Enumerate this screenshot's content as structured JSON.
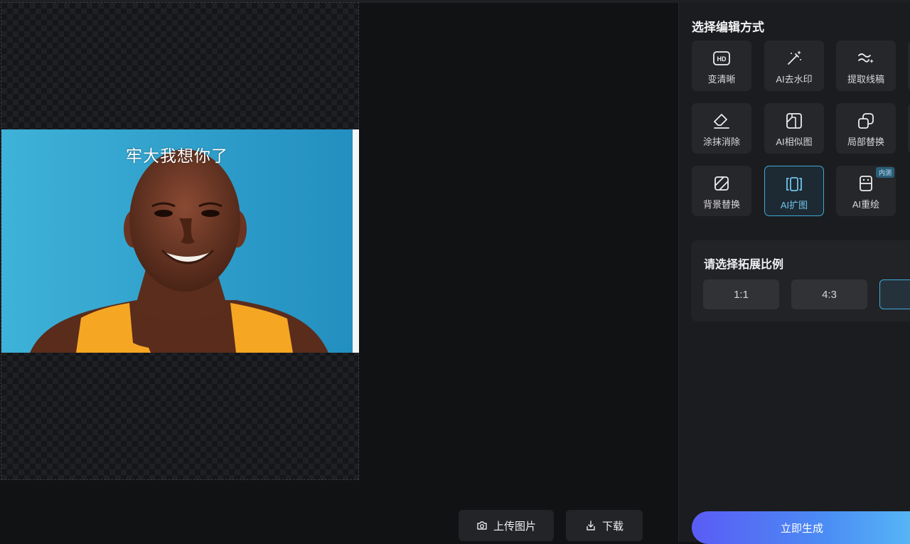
{
  "canvas": {
    "caption": "牢大我想你了"
  },
  "toolbar": {
    "upload_label": "上传图片",
    "download_label": "下载"
  },
  "panel": {
    "title": "选择编辑方式",
    "tools": [
      {
        "label": "变清晰",
        "icon": "hd-icon"
      },
      {
        "label": "AI去水印",
        "icon": "magic-wand-icon"
      },
      {
        "label": "提取线稿",
        "icon": "line-sparkle-icon"
      },
      {
        "label": "涂抹消除",
        "icon": "eraser-icon"
      },
      {
        "label": "AI相似图",
        "icon": "similar-image-icon"
      },
      {
        "label": "局部替换",
        "icon": "replace-icon"
      },
      {
        "label": "背景替换",
        "icon": "background-icon"
      },
      {
        "label": "AI扩图",
        "icon": "expand-icon",
        "active": true
      },
      {
        "label": "AI重绘",
        "icon": "redraw-icon",
        "badge": "内测"
      }
    ],
    "ratio": {
      "title": "请选择拓展比例",
      "options": [
        "1:1",
        "4:3",
        ""
      ],
      "selected_index": 2
    },
    "generate_label": "立即生成"
  },
  "colors": {
    "accent": "#3fa9d8",
    "gradient_start": "#5a5cf5",
    "gradient_end": "#56b6f6",
    "photo_background": "#2aa2d0",
    "jersey": "#f5a623"
  }
}
